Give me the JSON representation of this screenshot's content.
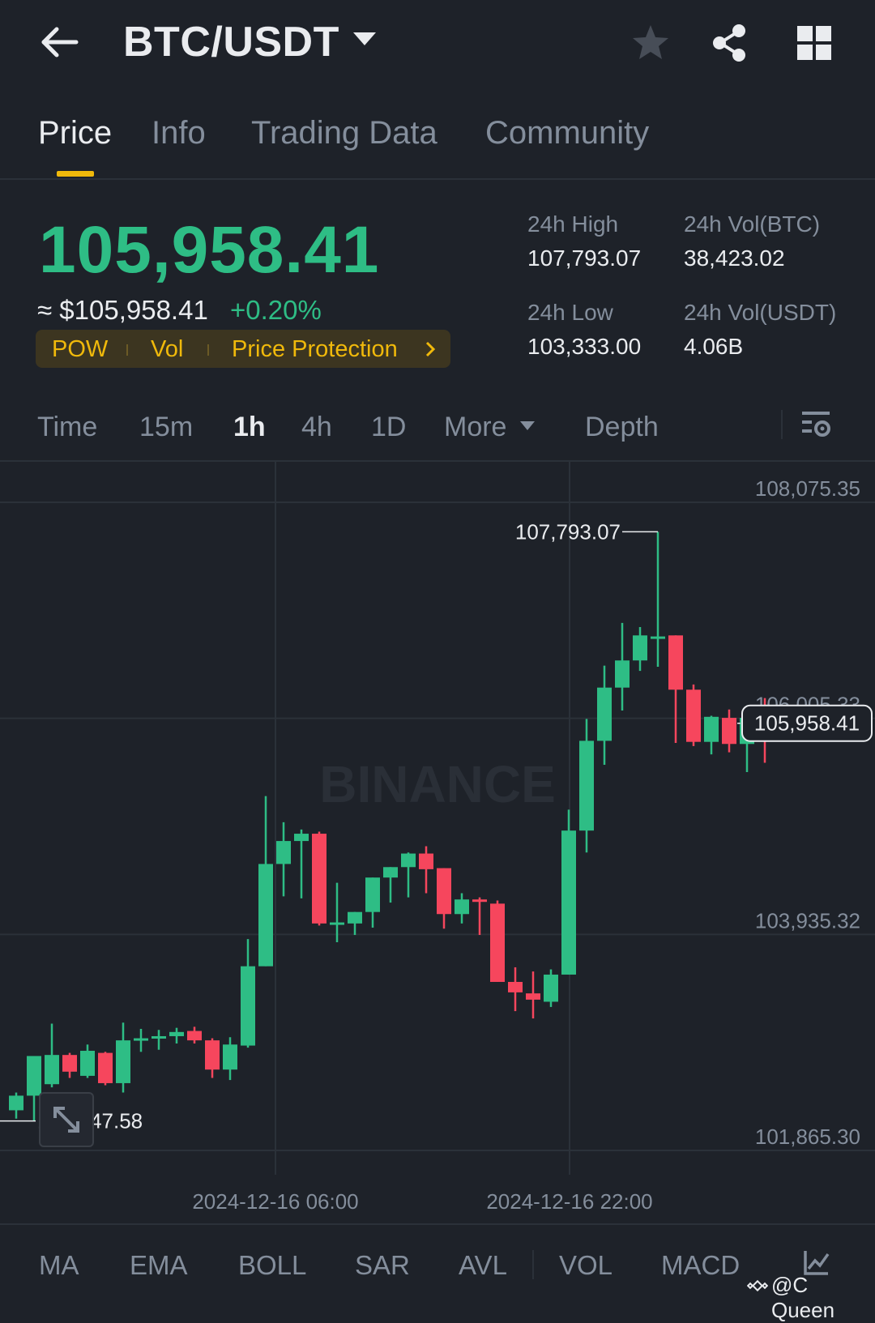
{
  "header": {
    "pair": "BTC/USDT",
    "icons": [
      "back-arrow-icon",
      "caret-down-icon",
      "star-icon",
      "share-icon",
      "grid-icon"
    ]
  },
  "tabs": [
    {
      "label": "Price",
      "active": true
    },
    {
      "label": "Info",
      "active": false
    },
    {
      "label": "Trading Data",
      "active": false
    },
    {
      "label": "Community",
      "active": false
    }
  ],
  "price": {
    "last": "105,958.41",
    "approx": "≈ $105,958.41",
    "change": "+0.20%",
    "tags": [
      "POW",
      "Vol",
      "Price Protection"
    ]
  },
  "stats": {
    "high_label": "24h High",
    "high_value": "107,793.07",
    "low_label": "24h Low",
    "low_value": "103,333.00",
    "vol_btc_label": "24h Vol(BTC)",
    "vol_btc_value": "38,423.02",
    "vol_usdt_label": "24h Vol(USDT)",
    "vol_usdt_value": "4.06B"
  },
  "intervals": [
    "Time",
    "15m",
    "1h",
    "4h",
    "1D",
    "More",
    "Depth"
  ],
  "active_interval": "1h",
  "indicators": [
    "MA",
    "EMA",
    "BOLL",
    "SAR",
    "AVL",
    "VOL",
    "MACD"
  ],
  "watermark": "@C Queen",
  "chart_watermark": "BINANCE",
  "colors": {
    "up": "#2ebd85",
    "down": "#f6465d",
    "accent": "#f0b90b",
    "bg": "#1e2229"
  },
  "chart_data": {
    "type": "candlestick",
    "y_ticks": [
      "108,075.35",
      "106,005.33",
      "103,935.32",
      "101,865.30"
    ],
    "y_tick_values": [
      108075.35,
      106005.33,
      103935.32,
      101865.3
    ],
    "x_ticks": [
      "2024-12-16 06:00",
      "2024-12-16 22:00"
    ],
    "last_price_label": "105,958.41",
    "last_price": 105958.41,
    "max_label": "107,793.07",
    "max_value": 107793.07,
    "min_label": "102,147.58",
    "min_value": 102147.58,
    "candles": [
      {
        "o": 102250,
        "h": 102420,
        "l": 102170,
        "c": 102390
      },
      {
        "o": 102390,
        "h": 102620,
        "l": 102147.58,
        "c": 102770
      },
      {
        "o": 102500,
        "h": 103080,
        "l": 102470,
        "c": 102780
      },
      {
        "o": 102780,
        "h": 102800,
        "l": 102560,
        "c": 102620
      },
      {
        "o": 102580,
        "h": 102880,
        "l": 102560,
        "c": 102820
      },
      {
        "o": 102800,
        "h": 102810,
        "l": 102490,
        "c": 102510
      },
      {
        "o": 102510,
        "h": 103090,
        "l": 102420,
        "c": 102920
      },
      {
        "o": 102930,
        "h": 103030,
        "l": 102810,
        "c": 102940
      },
      {
        "o": 102950,
        "h": 103020,
        "l": 102830,
        "c": 102960
      },
      {
        "o": 102960,
        "h": 103040,
        "l": 102890,
        "c": 103000
      },
      {
        "o": 103010,
        "h": 103050,
        "l": 102890,
        "c": 102920
      },
      {
        "o": 102920,
        "h": 102940,
        "l": 102560,
        "c": 102640
      },
      {
        "o": 102640,
        "h": 102950,
        "l": 102540,
        "c": 102880
      },
      {
        "o": 102870,
        "h": 103890,
        "l": 102850,
        "c": 103630
      },
      {
        "o": 103630,
        "h": 105260,
        "l": 103630,
        "c": 104610
      },
      {
        "o": 104610,
        "h": 105010,
        "l": 104300,
        "c": 104830
      },
      {
        "o": 104830,
        "h": 104940,
        "l": 104280,
        "c": 104900
      },
      {
        "o": 104900,
        "h": 104920,
        "l": 104020,
        "c": 104040
      },
      {
        "o": 104040,
        "h": 104430,
        "l": 103860,
        "c": 104050
      },
      {
        "o": 104040,
        "h": 104150,
        "l": 103930,
        "c": 104150
      },
      {
        "o": 104150,
        "h": 104370,
        "l": 104000,
        "c": 104480
      },
      {
        "o": 104480,
        "h": 104500,
        "l": 104240,
        "c": 104580
      },
      {
        "o": 104580,
        "h": 104720,
        "l": 104290,
        "c": 104710
      },
      {
        "o": 104710,
        "h": 104780,
        "l": 104330,
        "c": 104560
      },
      {
        "o": 104570,
        "h": 104560,
        "l": 103990,
        "c": 104130
      },
      {
        "o": 104130,
        "h": 104330,
        "l": 104040,
        "c": 104270
      },
      {
        "o": 104270,
        "h": 104290,
        "l": 103930,
        "c": 104260
      },
      {
        "o": 104230,
        "h": 104260,
        "l": 103520,
        "c": 103480
      },
      {
        "o": 103480,
        "h": 103620,
        "l": 103200,
        "c": 103380
      },
      {
        "o": 103370,
        "h": 103580,
        "l": 103130,
        "c": 103310
      },
      {
        "o": 103290,
        "h": 103600,
        "l": 103240,
        "c": 103550
      },
      {
        "o": 103550,
        "h": 105130,
        "l": 103550,
        "c": 104930
      },
      {
        "o": 104930,
        "h": 106000,
        "l": 104720,
        "c": 105790
      },
      {
        "o": 105790,
        "h": 106510,
        "l": 105560,
        "c": 106300
      },
      {
        "o": 106300,
        "h": 106920,
        "l": 106080,
        "c": 106560
      },
      {
        "o": 106560,
        "h": 106880,
        "l": 106460,
        "c": 106800
      },
      {
        "o": 106770,
        "h": 107793.07,
        "l": 106500,
        "c": 106790
      },
      {
        "o": 106800,
        "h": 106740,
        "l": 105770,
        "c": 106280
      },
      {
        "o": 106280,
        "h": 106330,
        "l": 105740,
        "c": 105780
      },
      {
        "o": 105780,
        "h": 106030,
        "l": 105660,
        "c": 106020
      },
      {
        "o": 106010,
        "h": 106090,
        "l": 105680,
        "c": 105760
      },
      {
        "o": 105760,
        "h": 106030,
        "l": 105490,
        "c": 106010
      },
      {
        "o": 106010,
        "h": 106200,
        "l": 105580,
        "c": 105958.41
      }
    ]
  }
}
